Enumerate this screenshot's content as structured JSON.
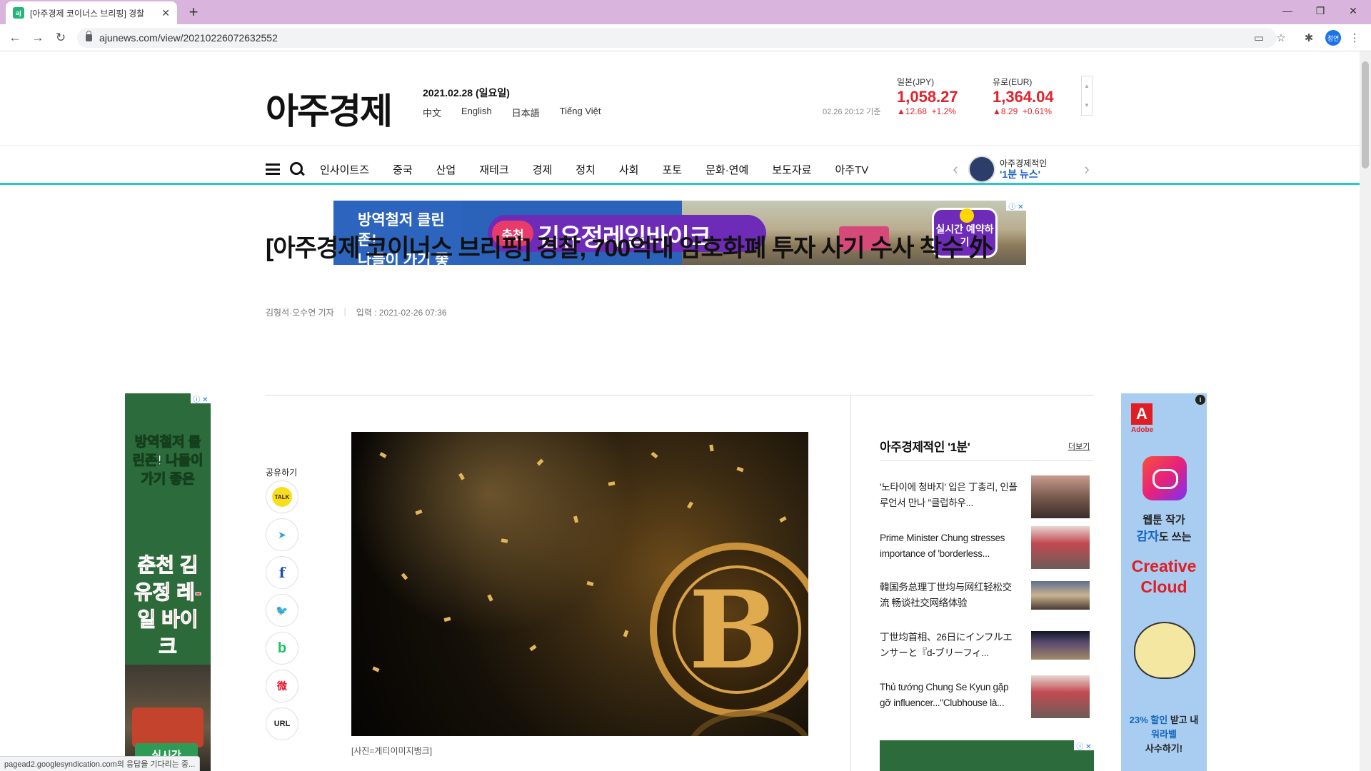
{
  "browser": {
    "tab_title": "[아주경제 코이너스 브리핑] 경찰",
    "favicon_text": "ajunews",
    "url": "ajunews.com/view/20210226072632552",
    "profile_initials": "정연"
  },
  "header": {
    "logo": "아주경제",
    "date": "2021.02.28 (일요일)",
    "languages": [
      "中文",
      "English",
      "日本語",
      "Tiếng Việt"
    ],
    "fx_time": "02.26 20:12 기준",
    "fx": [
      {
        "name": "일본(JPY)",
        "value": "1,058.27",
        "change": "12.68",
        "pct": "+1.2%"
      },
      {
        "name": "유로(EUR)",
        "value": "1,364.04",
        "change": "8.29",
        "pct": "+0.61%"
      }
    ]
  },
  "nav": {
    "menu": [
      "인사이트즈",
      "중국",
      "산업",
      "재테크",
      "경제",
      "정치",
      "사회",
      "포토",
      "문화·연예",
      "보도자료",
      "아주TV"
    ],
    "minute_label": "아주경제적인",
    "minute_title": "'1분 뉴스'"
  },
  "ads": {
    "top": {
      "left_line1": "방역철저 클린존!",
      "left_line2": "나들이 가기 좋은",
      "chip": "춘천",
      "title": "김유정레일바이크",
      "cta": "실시간 예약하기"
    },
    "left": {
      "line1": "방역철저 클린존! 나들이 가기 좋은",
      "line2": "춘천 김유정 레-일 바이크",
      "cta": "실시간"
    },
    "right": {
      "brand": "Adobe",
      "line1": "웹툰 작가",
      "line2_highlight": "감자",
      "line2_rest": "도 쓰는",
      "product": "Creative Cloud",
      "promo_highlight": "23% 할인",
      "promo_rest": "받고 내",
      "promo_highlight2": "워라밸",
      "promo_end": "사수하기!"
    }
  },
  "article": {
    "headline": "[아주경제 코이너스 브리핑] 경찰, 700억대 암호화폐 투자 사기 수사 착수 外",
    "author": "김형석·오수연 기자",
    "published": "입력 : 2021-02-26 07:36",
    "caption": "[사진=게티이미지뱅크]",
    "share_label": "공유하기",
    "share": [
      {
        "name": "kakao",
        "label": "TALK"
      },
      {
        "name": "telegram",
        "label": "➤"
      },
      {
        "name": "facebook",
        "label": "f"
      },
      {
        "name": "twitter",
        "label": "🐦"
      },
      {
        "name": "band",
        "label": "b"
      },
      {
        "name": "weibo",
        "label": "微"
      },
      {
        "name": "url",
        "label": "URL"
      }
    ]
  },
  "sidebar": {
    "title": "아주경제적인 '1분'",
    "more": "더보기",
    "items": [
      {
        "title": "'노타이에 청바지' 입은 丁총리, 인플루언서 만나 \"클럽하우..."
      },
      {
        "title": "Prime Minister Chung stresses importance of 'borderless..."
      },
      {
        "title": "韓国务总理丁世均与网红轻松交流 畅谈社交网络体验"
      },
      {
        "title": "丁世均首相、26日にインフルエンサーと『d-ブリーフィ..."
      },
      {
        "title": "Thủ tướng Chung Se Kyun gặp gỡ influencer...\"Clubhouse là..."
      }
    ]
  },
  "statusbar": "pagead2.googlesyndication.com의 응답을 기다리는 중..."
}
